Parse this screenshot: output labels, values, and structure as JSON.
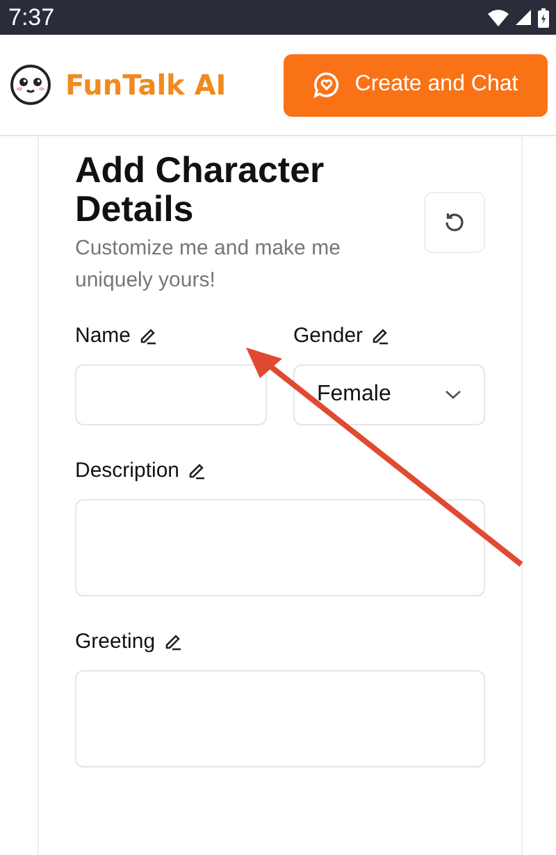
{
  "status_bar": {
    "time": "7:37"
  },
  "header": {
    "brand": "FunTalk AI",
    "button": "Create and Chat"
  },
  "form": {
    "title": "Add Character Details",
    "subtitle": "Customize me and make me uniquely yours!",
    "fields": [
      {
        "label": "Name",
        "kind": "text"
      },
      {
        "label": "Gender",
        "kind": "select",
        "value": "Female"
      },
      {
        "label": "Description",
        "kind": "textarea"
      },
      {
        "label": "Greeting",
        "kind": "textarea"
      }
    ]
  }
}
